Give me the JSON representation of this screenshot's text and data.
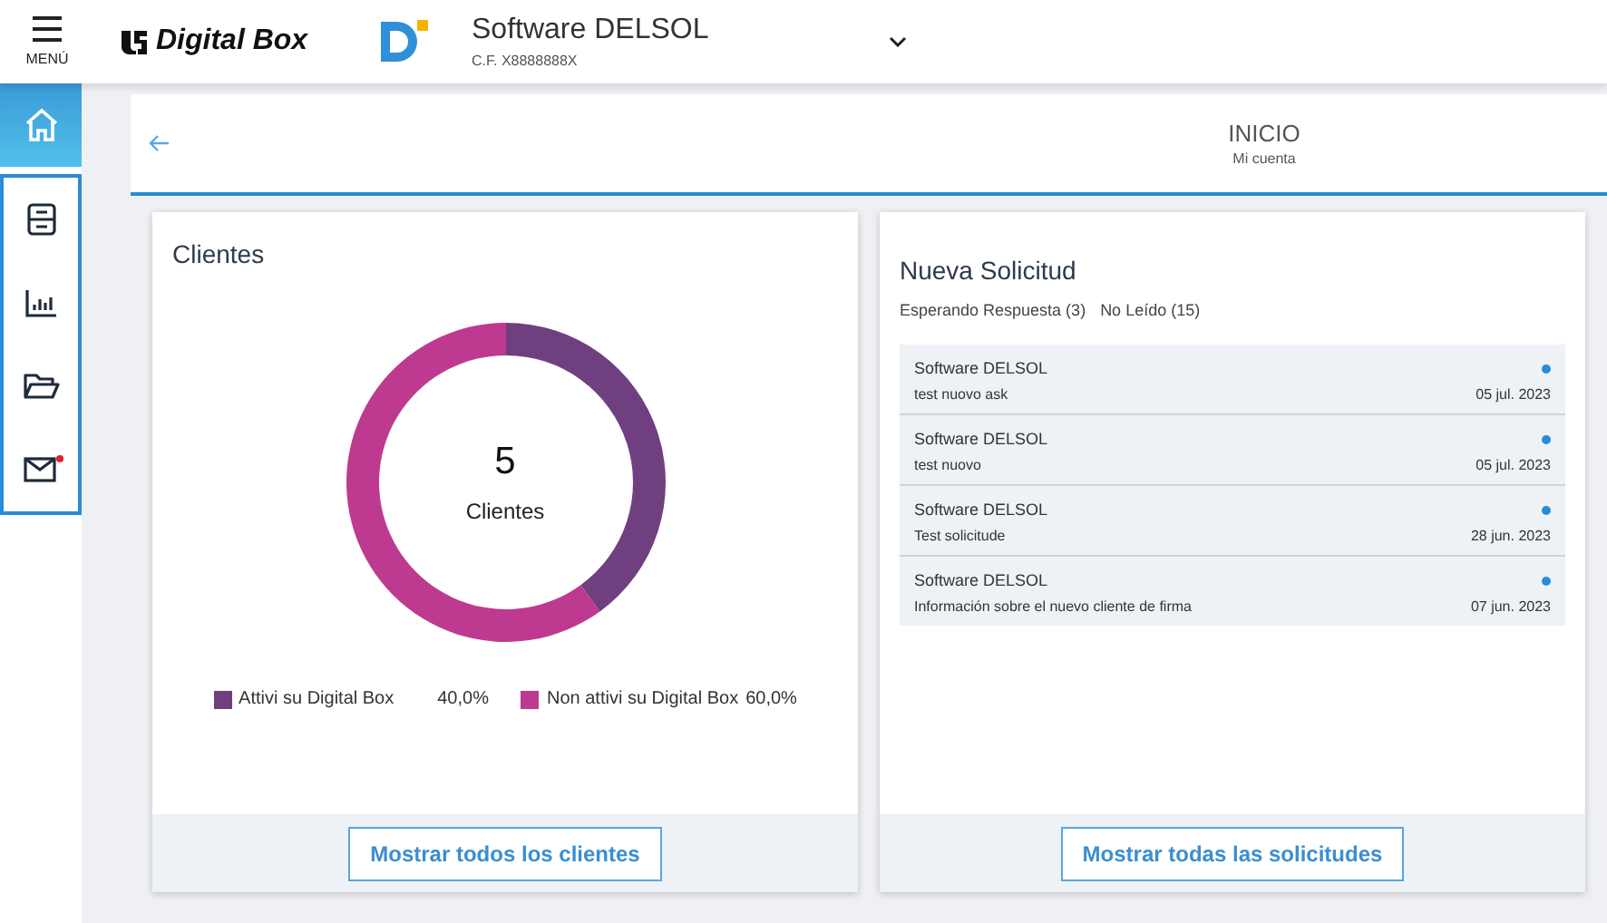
{
  "topbar": {
    "menu_label": "MENÚ",
    "brand": "Digital Box",
    "company": "Software DELSOL",
    "tax_id": "C.F. X8888888X"
  },
  "sidebar": {
    "items": [
      {
        "kind": "home",
        "selected": true,
        "badge": false
      },
      {
        "kind": "archive",
        "selected": false,
        "badge": false
      },
      {
        "kind": "chart",
        "selected": false,
        "badge": false
      },
      {
        "kind": "folder",
        "selected": false,
        "badge": false
      },
      {
        "kind": "mail",
        "selected": false,
        "badge": true
      }
    ]
  },
  "header": {
    "title": "INICIO",
    "subtitle": "Mi cuenta"
  },
  "clients_card": {
    "title": "Clientes",
    "center_value": "5",
    "center_label": "Clientes",
    "chart_data": {
      "type": "donut",
      "categories": [
        "Attivi su Digital Box",
        "Non attivi su Digital Box"
      ],
      "values": [
        40,
        60
      ]
    },
    "legend": [
      {
        "value": "40,0%",
        "color": "#6f3f80"
      },
      {
        "value": "60,0%",
        "color": "#bd3a90"
      }
    ],
    "button": "Mostrar todos los clientes"
  },
  "requests_card": {
    "title": "Nueva Solicitud",
    "filters": [
      "Esperando Respuesta (3)",
      "No Leído (15)"
    ],
    "items": [
      {
        "sender": "Software DELSOL",
        "subject": "test nuovo ask",
        "date": "05 jul. 2023",
        "unread": true
      },
      {
        "sender": "Software DELSOL",
        "subject": "test nuovo",
        "date": "05 jul. 2023",
        "unread": true
      },
      {
        "sender": "Software DELSOL",
        "subject": "Test solicitude",
        "date": "28 jun. 2023",
        "unread": true
      },
      {
        "sender": "Software DELSOL",
        "subject": "Información sobre el nuevo cliente de firma",
        "date": "07 jun. 2023",
        "unread": true
      }
    ],
    "button": "Mostrar todas las solicitudes"
  }
}
